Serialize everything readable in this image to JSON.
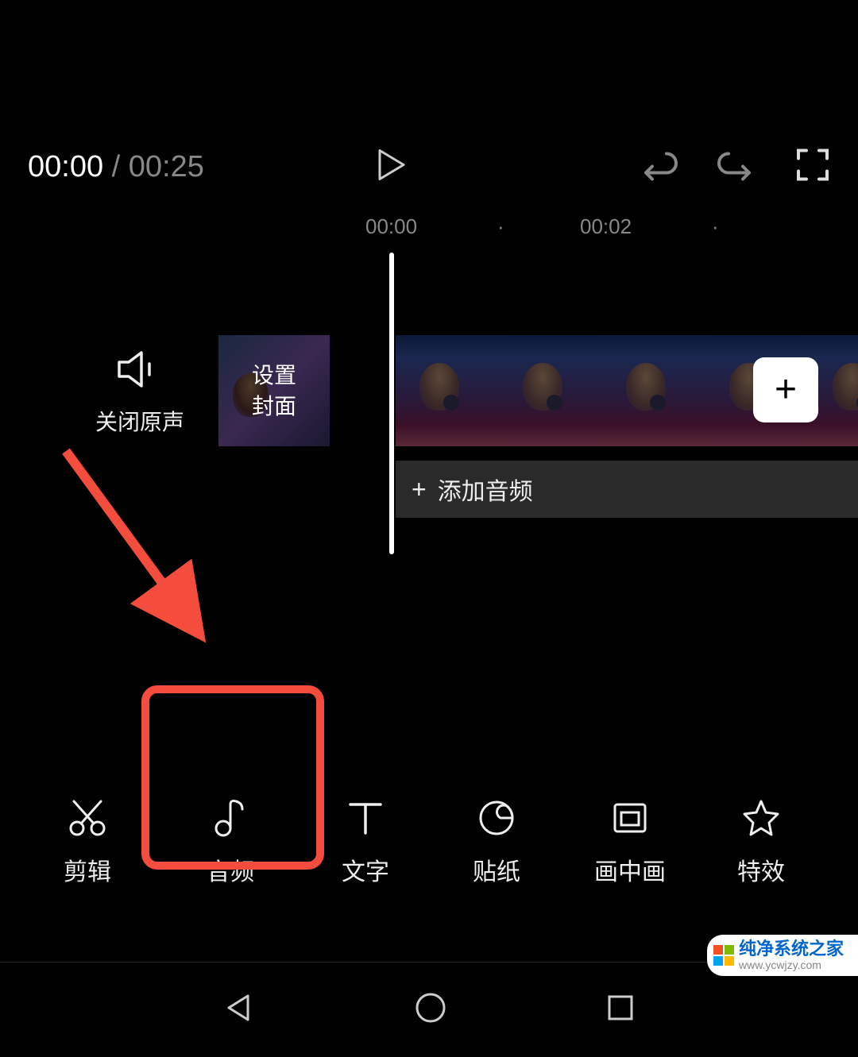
{
  "player": {
    "current_time": "00:00",
    "separator": " / ",
    "total_time": "00:25"
  },
  "ruler": {
    "tick1": "00:00",
    "dot": "·",
    "tick2": "00:02"
  },
  "mute": {
    "label": "关闭原声"
  },
  "cover": {
    "line1": "设置",
    "line2": "封面"
  },
  "add_clip": {
    "symbol": "+"
  },
  "add_audio": {
    "plus": "+",
    "label": "添加音频"
  },
  "toolbar": {
    "items": [
      {
        "label": "剪辑"
      },
      {
        "label": "音频"
      },
      {
        "label": "文字"
      },
      {
        "label": "贴纸"
      },
      {
        "label": "画中画"
      },
      {
        "label": "特效"
      }
    ]
  },
  "watermark": {
    "text": "纯净系统之家",
    "url": "www.ycwjzy.com"
  }
}
